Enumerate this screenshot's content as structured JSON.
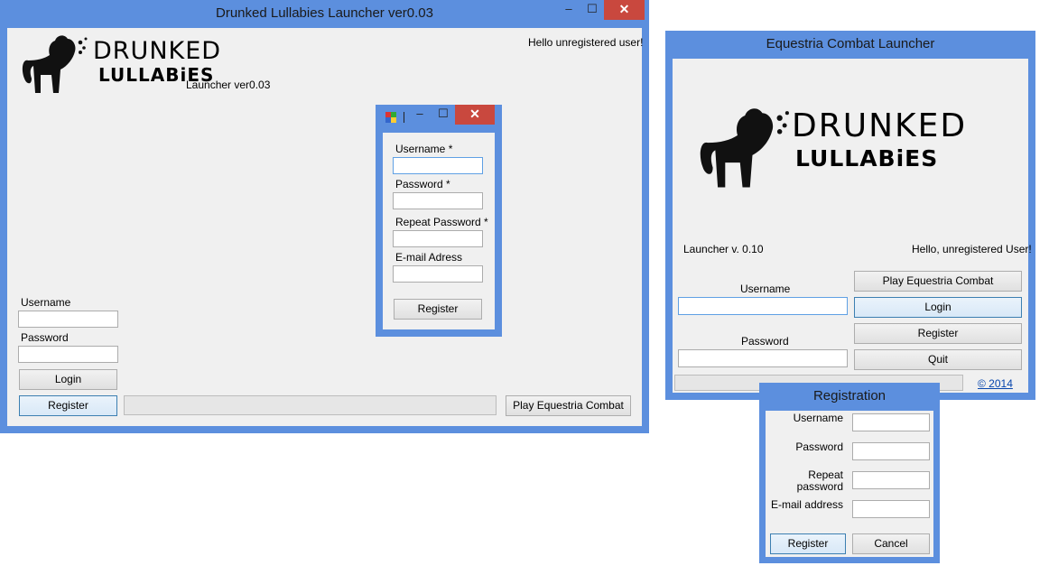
{
  "main_window": {
    "title": "Drunked Lullabies Launcher ver0.03",
    "minimize": "–",
    "maximize": "☐",
    "close": "✕",
    "greeting": "Hello unregistered user!",
    "logo_text_1": "DRUNKED",
    "logo_text_2": "LULLABiES",
    "version": "Launcher ver0.03",
    "username_label": "Username",
    "password_label": "Password",
    "login_button": "Login",
    "register_button": "Register",
    "play_button": "Play Equestria Combat"
  },
  "register_dialog": {
    "username_label": "Username *",
    "password_label": "Password *",
    "repeat_label": "Repeat Password *",
    "email_label": "E-mail Adress",
    "register_button": "Register",
    "minimize": "–",
    "maximize": "☐",
    "close": "✕"
  },
  "equestria_window": {
    "title": "Equestria Combat Launcher",
    "logo_text_1": "DRUNKED",
    "logo_text_2": "LULLABiES",
    "version": "Launcher v. 0.10",
    "greeting": "Hello, unregistered User!",
    "username_label": "Username",
    "password_label": "Password",
    "play_button": "Play Equestria Combat",
    "login_button": "Login",
    "register_button": "Register",
    "quit_button": "Quit",
    "copyright": "© 2014"
  },
  "registration_window": {
    "title": "Registration",
    "username_label": "Username",
    "password_label": "Password",
    "repeat_label_1": "Repeat",
    "repeat_label_2": "password",
    "email_label": "E-mail address",
    "register_button": "Register",
    "cancel_button": "Cancel"
  }
}
